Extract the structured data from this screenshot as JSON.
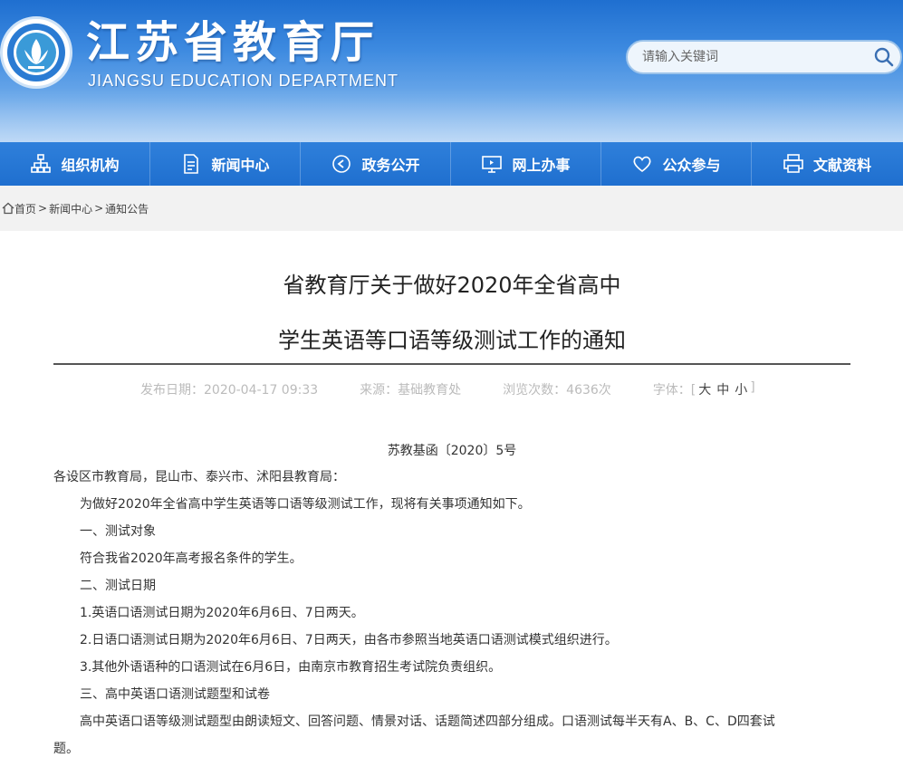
{
  "header": {
    "title_cn": "江苏省教育厅",
    "title_en": "JIANGSU EDUCATION DEPARTMENT",
    "search_placeholder": "请输入关键词",
    "brand_color": "#1f6fd0"
  },
  "nav": {
    "items": [
      {
        "label": "组织机构",
        "icon": "org-chart-icon"
      },
      {
        "label": "新闻中心",
        "icon": "document-icon"
      },
      {
        "label": "政务公开",
        "icon": "play-circle-icon"
      },
      {
        "label": "网上办事",
        "icon": "monitor-icon"
      },
      {
        "label": "公众参与",
        "icon": "heart-icon"
      },
      {
        "label": "文献资料",
        "icon": "printer-icon"
      }
    ]
  },
  "breadcrumb": {
    "home": "首页",
    "sep": ">",
    "news": "新闻中心",
    "notice": "通知公告"
  },
  "article": {
    "title_line1": "省教育厅关于做好2020年全省高中",
    "title_line2": "学生英语等口语等级测试工作的通知",
    "meta_date": "发布日期：2020-04-17 09:33",
    "meta_source": "来源：基础教育处",
    "meta_views": "浏览次数：4636次",
    "meta_font_label": "字体：[",
    "font_large": "大",
    "font_medium": "中",
    "font_small": "小",
    "meta_font_end": "]",
    "doc_number": "苏教基函〔2020〕5号",
    "paragraphs": [
      "各设区市教育局，昆山市、泰兴市、沭阳县教育局：",
      "为做好2020年全省高中学生英语等口语等级测试工作，现将有关事项通知如下。",
      "一、测试对象",
      "符合我省2020年高考报名条件的学生。",
      "二、测试日期",
      "1.英语口语测试日期为2020年6月6日、7日两天。",
      "2.日语口语测试日期为2020年6月6日、7日两天，由各市参照当地英语口语测试模式组织进行。",
      "3.其他外语语种的口语测试在6月6日，由南京市教育招生考试院负责组织。",
      "三、高中英语口语测试题型和试卷",
      "高中英语口语等级测试题型由朗读短文、回答问题、情景对话、话题简述四部分组成。口语测试每半天有A、B、C、D四套试",
      "题。"
    ]
  }
}
